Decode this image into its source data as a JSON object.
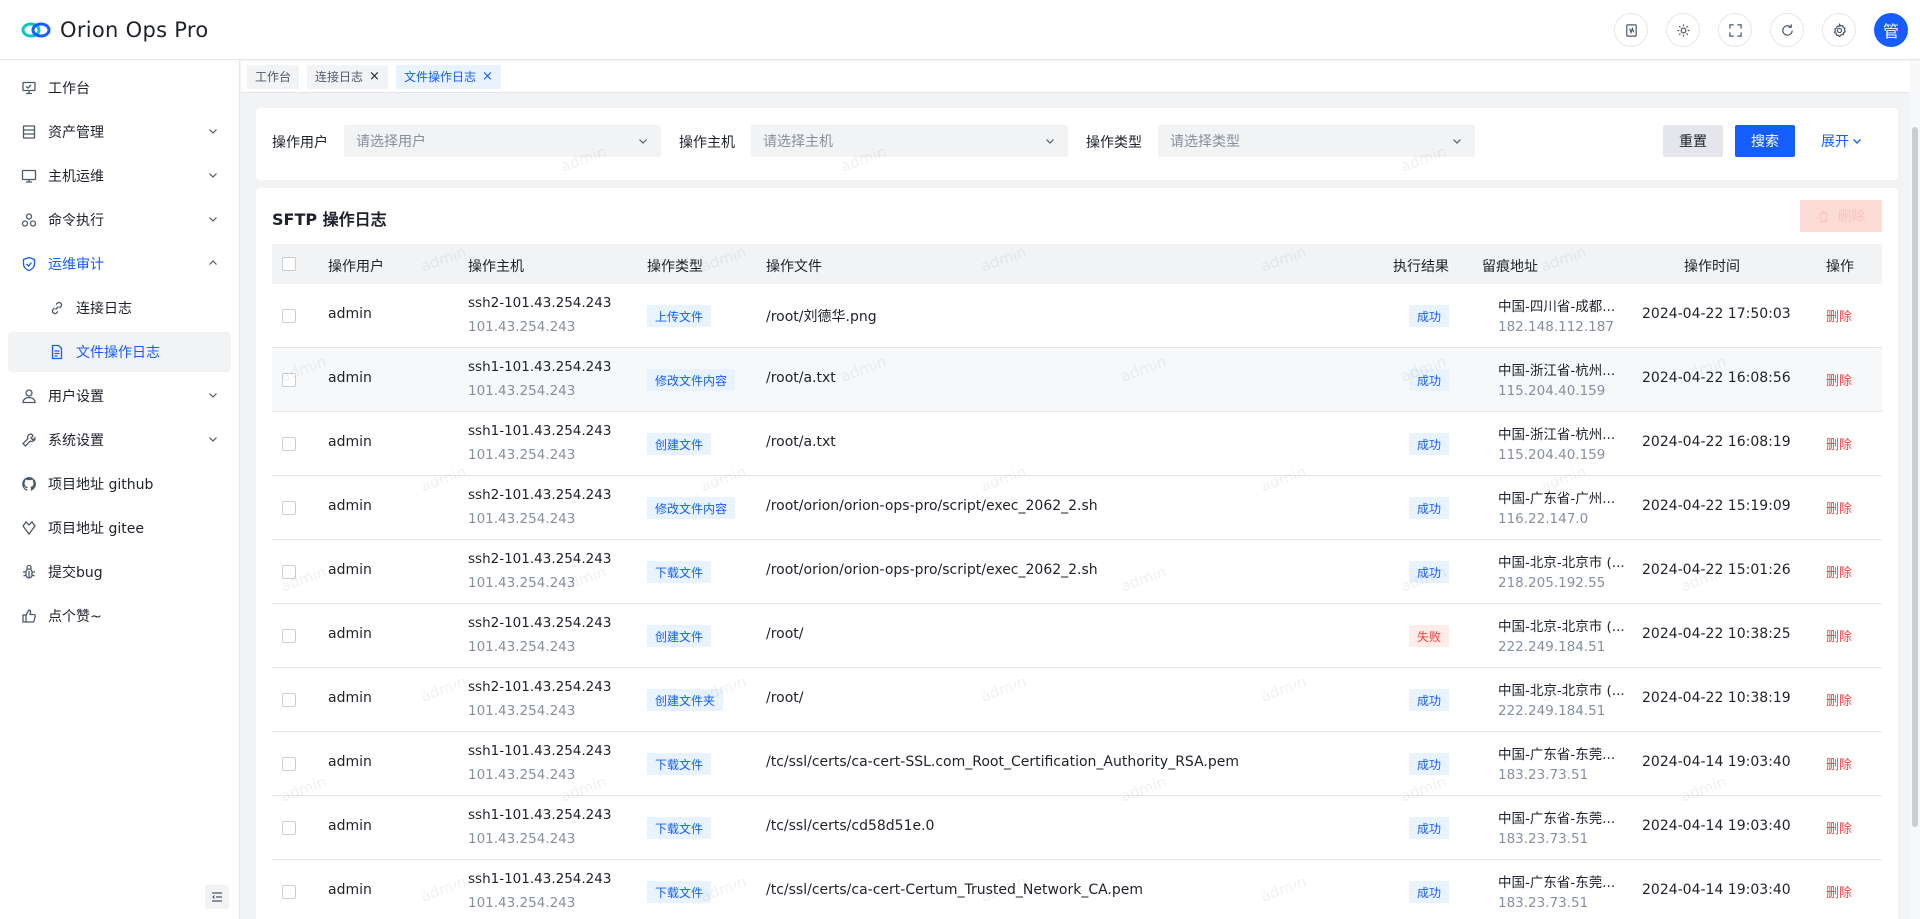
{
  "app": {
    "title": "Orion Ops Pro",
    "accent": "#165dff"
  },
  "header": {
    "avatar_text": "管",
    "icons": [
      "doc-icon",
      "theme-icon",
      "fullscreen-icon",
      "refresh-icon",
      "settings-icon"
    ]
  },
  "sidebar": {
    "items": [
      {
        "label": "工作台",
        "icon": "workbench-icon"
      },
      {
        "label": "资产管理",
        "icon": "asset-icon"
      },
      {
        "label": "主机运维",
        "icon": "monitor-icon"
      },
      {
        "label": "命令执行",
        "icon": "command-icon"
      },
      {
        "label": "运维审计",
        "icon": "shield-icon"
      },
      {
        "label": "连接日志",
        "icon": "link-icon"
      },
      {
        "label": "文件操作日志",
        "icon": "file-icon"
      },
      {
        "label": "用户设置",
        "icon": "user-icon"
      },
      {
        "label": "系统设置",
        "icon": "wrench-icon"
      },
      {
        "label": "项目地址 github",
        "icon": "github-icon"
      },
      {
        "label": "项目地址 gitee",
        "icon": "gitee-icon"
      },
      {
        "label": "提交bug",
        "icon": "bug-icon"
      },
      {
        "label": "点个赞~",
        "icon": "thumbs-up-icon"
      }
    ]
  },
  "tabs": [
    {
      "label": "工作台"
    },
    {
      "label": "连接日志",
      "close": "×"
    },
    {
      "label": "文件操作日志",
      "close": "×"
    }
  ],
  "filter": {
    "user_label": "操作用户",
    "user_placeholder": "请选择用户",
    "host_label": "操作主机",
    "host_placeholder": "请选择主机",
    "type_label": "操作类型",
    "type_placeholder": "请选择类型",
    "reset": "重置",
    "search": "搜索",
    "expand": "展开"
  },
  "table": {
    "title": "SFTP 操作日志",
    "delete_button": "删除",
    "watermark": "admin",
    "columns": [
      "操作用户",
      "操作主机",
      "操作类型",
      "操作文件",
      "执行结果",
      "留痕地址",
      "操作时间",
      "操作"
    ],
    "rows": [
      {
        "user": "admin",
        "host": "ssh2-101.43.254.243",
        "ip": "101.43.254.243",
        "type": "上传文件",
        "file": "/root/刘德华.png",
        "result": "成功",
        "status": "ok",
        "addr": "中国-四川省-成都...",
        "addr_ip": "182.148.112.187",
        "time": "2024-04-22 17:50:03",
        "action": "删除"
      },
      {
        "user": "admin",
        "host": "ssh1-101.43.254.243",
        "ip": "101.43.254.243",
        "type": "修改文件内容",
        "file": "/root/a.txt",
        "result": "成功",
        "status": "ok",
        "addr": "中国-浙江省-杭州...",
        "addr_ip": "115.204.40.159",
        "time": "2024-04-22 16:08:56",
        "action": "删除"
      },
      {
        "user": "admin",
        "host": "ssh1-101.43.254.243",
        "ip": "101.43.254.243",
        "type": "创建文件",
        "file": "/root/a.txt",
        "result": "成功",
        "status": "ok",
        "addr": "中国-浙江省-杭州...",
        "addr_ip": "115.204.40.159",
        "time": "2024-04-22 16:08:19",
        "action": "删除"
      },
      {
        "user": "admin",
        "host": "ssh2-101.43.254.243",
        "ip": "101.43.254.243",
        "type": "修改文件内容",
        "file": "/root/orion/orion-ops-pro/script/exec_2062_2.sh",
        "result": "成功",
        "status": "ok",
        "addr": "中国-广东省-广州...",
        "addr_ip": "116.22.147.0",
        "time": "2024-04-22 15:19:09",
        "action": "删除"
      },
      {
        "user": "admin",
        "host": "ssh2-101.43.254.243",
        "ip": "101.43.254.243",
        "type": "下载文件",
        "file": "/root/orion/orion-ops-pro/script/exec_2062_2.sh",
        "result": "成功",
        "status": "ok",
        "addr": "中国-北京-北京市 (...",
        "addr_ip": "218.205.192.55",
        "time": "2024-04-22 15:01:26",
        "action": "删除"
      },
      {
        "user": "admin",
        "host": "ssh2-101.43.254.243",
        "ip": "101.43.254.243",
        "type": "创建文件",
        "file": "/root/",
        "result": "失败",
        "status": "fail",
        "addr": "中国-北京-北京市 (...",
        "addr_ip": "222.249.184.51",
        "time": "2024-04-22 10:38:25",
        "action": "删除"
      },
      {
        "user": "admin",
        "host": "ssh2-101.43.254.243",
        "ip": "101.43.254.243",
        "type": "创建文件夹",
        "file": "/root/",
        "result": "成功",
        "status": "ok",
        "addr": "中国-北京-北京市 (...",
        "addr_ip": "222.249.184.51",
        "time": "2024-04-22 10:38:19",
        "action": "删除"
      },
      {
        "user": "admin",
        "host": "ssh1-101.43.254.243",
        "ip": "101.43.254.243",
        "type": "下载文件",
        "file": "/tc/ssl/certs/ca-cert-SSL.com_Root_Certification_Authority_RSA.pem",
        "result": "成功",
        "status": "ok",
        "addr": "中国-广东省-东莞...",
        "addr_ip": "183.23.73.51",
        "time": "2024-04-14 19:03:40",
        "action": "删除"
      },
      {
        "user": "admin",
        "host": "ssh1-101.43.254.243",
        "ip": "101.43.254.243",
        "type": "下载文件",
        "file": "/tc/ssl/certs/cd58d51e.0",
        "result": "成功",
        "status": "ok",
        "addr": "中国-广东省-东莞...",
        "addr_ip": "183.23.73.51",
        "time": "2024-04-14 19:03:40",
        "action": "删除"
      },
      {
        "user": "admin",
        "host": "ssh1-101.43.254.243",
        "ip": "101.43.254.243",
        "type": "下载文件",
        "file": "/tc/ssl/certs/ca-cert-Certum_Trusted_Network_CA.pem",
        "result": "成功",
        "status": "ok",
        "addr": "中国-广东省-东莞...",
        "addr_ip": "183.23.73.51",
        "time": "2024-04-14 19:03:40",
        "action": "删除"
      }
    ]
  }
}
